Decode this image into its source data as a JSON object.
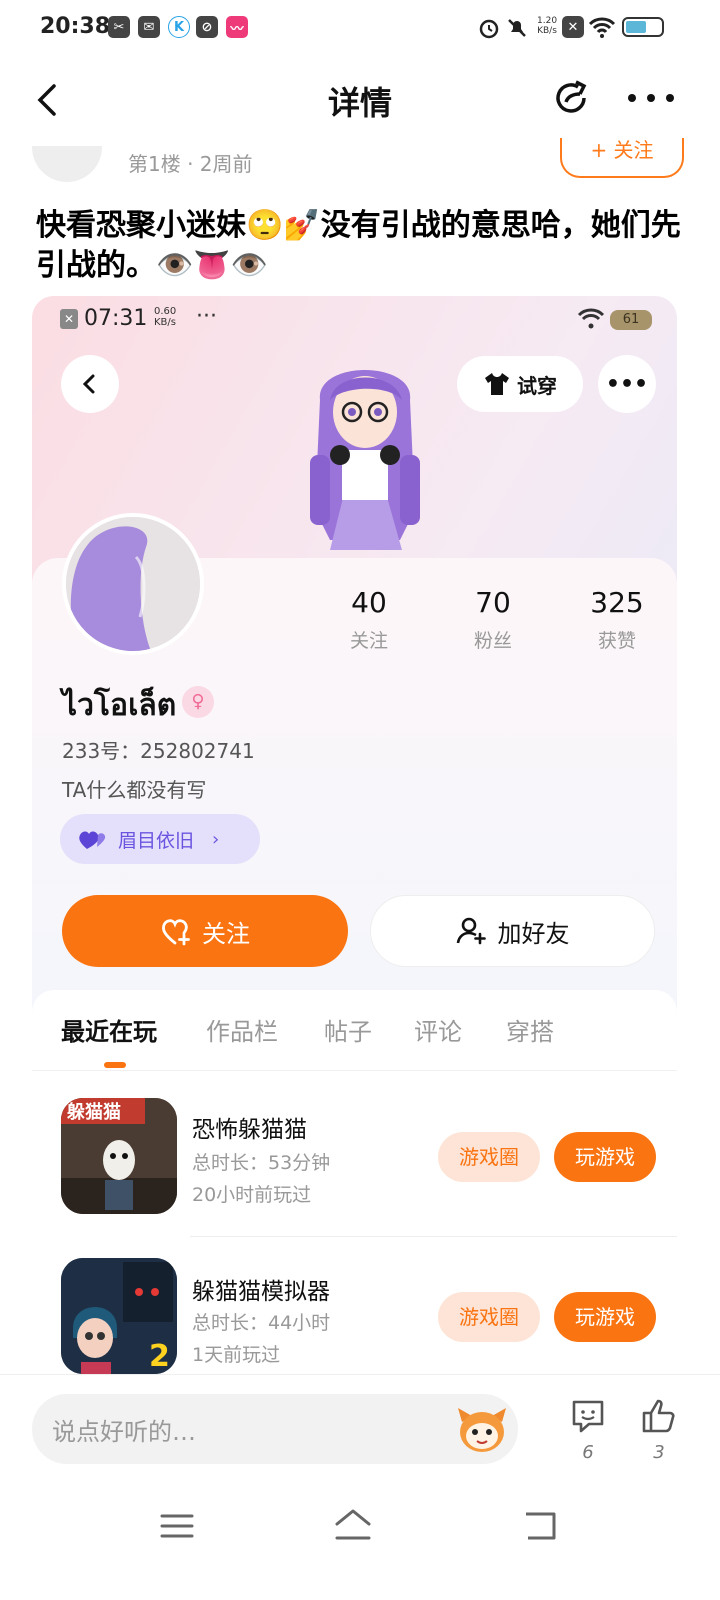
{
  "status_bar": {
    "time": "20:38",
    "speed_value": "1.20",
    "speed_unit": "KB/s"
  },
  "header": {
    "title": "详情"
  },
  "post": {
    "floor_meta": "第1楼 · 2周前",
    "follow_label": "+ 关注",
    "text": "快看恐聚小迷妹🙄💅没有引战的意思哈，她们先引战的。👁️👅👁️"
  },
  "profile_card": {
    "status_time": "07:31",
    "status_speed_value": "0.60",
    "status_speed_unit": "KB/s",
    "battery": "61",
    "try_on_label": "试穿",
    "stats": [
      {
        "value": "40",
        "label": "关注"
      },
      {
        "value": "70",
        "label": "粉丝"
      },
      {
        "value": "325",
        "label": "获赞"
      }
    ],
    "username": "ไวโอเล็ต",
    "uid": "233号：252802741",
    "bio": "TA什么都没有写",
    "badge": "眉目依旧",
    "follow_button": "关注",
    "add_friend_button": "加好友",
    "tabs": [
      "最近在玩",
      "作品栏",
      "帖子",
      "评论",
      "穿搭"
    ],
    "games": [
      {
        "name": "恐怖躲猫猫",
        "duration": "总时长：53分钟",
        "last_played": "20小时前玩过",
        "circle_button": "游戏圈",
        "play_button": "玩游戏",
        "icon_text": "躲猫猫"
      },
      {
        "name": "躲猫猫模拟器",
        "duration": "总时长：44小时",
        "last_played": "1天前玩过",
        "circle_button": "游戏圈",
        "play_button": "玩游戏",
        "icon_text": "2"
      }
    ]
  },
  "bottom_bar": {
    "comment_placeholder": "说点好听的…",
    "comment_count": "6",
    "like_count": "3"
  },
  "colors": {
    "accent": "#fa7411",
    "badge": "#6b55e0"
  }
}
